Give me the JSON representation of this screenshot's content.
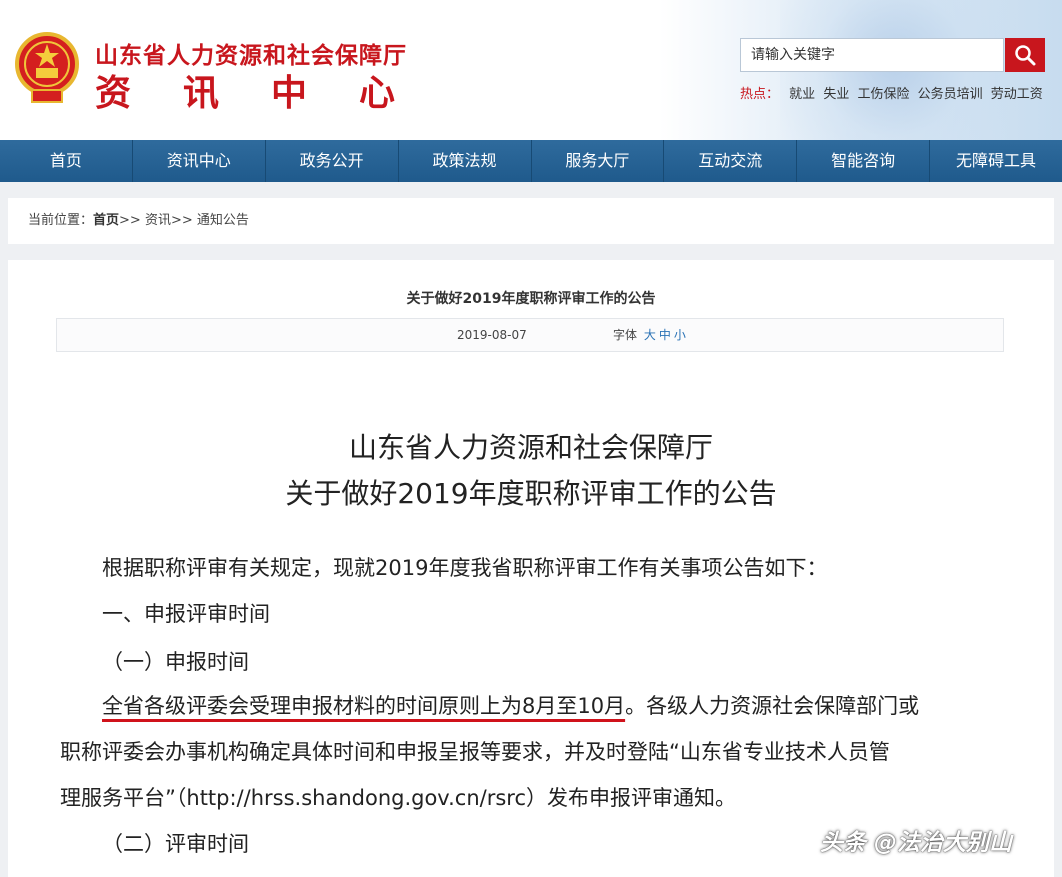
{
  "header": {
    "site_title": "山东省人力资源和社会保障厅",
    "site_subtitle_chars": [
      "资",
      "讯",
      "中",
      "心"
    ],
    "search_placeholder": "请输入关键字",
    "hot_label": "热点：",
    "hot_items": [
      "就业",
      "失业",
      "工伤保险",
      "公务员培训",
      "劳动工资"
    ],
    "colors": {
      "brand_red": "#c8161d",
      "nav_blue": "#1f5a8c"
    }
  },
  "nav": {
    "items": [
      "首页",
      "资讯中心",
      "政务公开",
      "政策法规",
      "服务大厅",
      "互动交流",
      "智能咨询",
      "无障碍工具"
    ]
  },
  "breadcrumb": {
    "prefix": "当前位置：",
    "home": "首页",
    "sep": ">>",
    "level2": "资讯",
    "level3": "通知公告"
  },
  "article": {
    "title": "关于做好2019年度职称评审工作的公告",
    "date": "2019-08-07",
    "font_label": "字体",
    "font_sizes": [
      "大",
      "中",
      "小"
    ],
    "heading_line1": "山东省人力资源和社会保障厅",
    "heading_line2": "关于做好2019年度职称评审工作的公告",
    "intro": "根据职称评审有关规定，现就2019年度我省职称评审工作有关事项公告如下：",
    "section1": "一、申报评审时间",
    "sub1": "（一）申报时间",
    "body1_prefix": "全省",
    "body1_highlight": "各级评委会受理申报材料的时间原则上为8月至10月",
    "body1_suffix": "。各级人力资源社会保障部门或",
    "body2": "职称评委会办事机构确定具体时间和申报呈报等要求，并及时登陆“山东省专业技术人员管",
    "body3": "理服务平台”（http://hrss.shandong.gov.cn/rsrc）发布申报评审通知。",
    "sub2": "（二）评审时间"
  },
  "watermark": "头条 @法治大别山"
}
